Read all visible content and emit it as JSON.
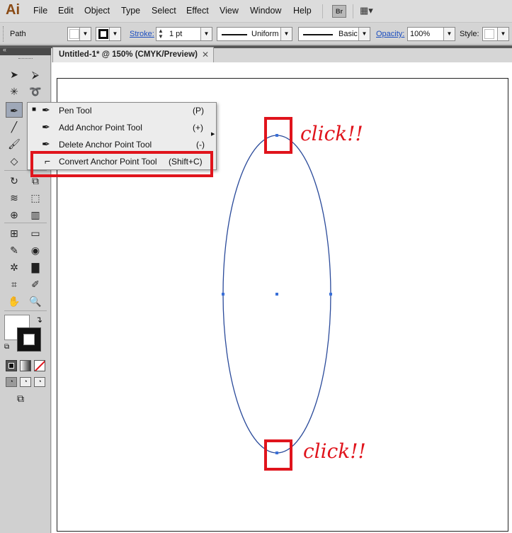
{
  "app": {
    "logo": "Ai"
  },
  "menu": [
    "File",
    "Edit",
    "Object",
    "Type",
    "Select",
    "Effect",
    "View",
    "Window",
    "Help"
  ],
  "menu_extra": {
    "bridge": "Br",
    "arrange": "▦▾"
  },
  "control_bar": {
    "selection_type": "Path",
    "stroke_label": "Stroke:",
    "stroke_weight": "1 pt",
    "profile": "Uniform",
    "brush": "Basic",
    "opacity_label": "Opacity:",
    "opacity_value": "100%",
    "style_label": "Style:"
  },
  "document_tab": {
    "title": "Untitled-1* @ 150% (CMYK/Preview)",
    "close": "✕"
  },
  "flyout": {
    "items": [
      {
        "label": "Pen Tool",
        "shortcut": "(P)",
        "selected": true
      },
      {
        "label": "Add Anchor Point Tool",
        "shortcut": "(+)",
        "selected": false
      },
      {
        "label": "Delete Anchor Point Tool",
        "shortcut": "(-)",
        "selected": false
      },
      {
        "label": "Convert Anchor Point Tool",
        "shortcut": "(Shift+C)",
        "selected": false
      }
    ]
  },
  "annotations": {
    "click_top": "click!!",
    "click_bottom": "click!!",
    "color": "#e0141c"
  },
  "tools": [
    "selection-tool",
    "direct-selection-tool",
    "magic-wand-tool",
    "lasso-tool",
    "pen-tool",
    "type-tool",
    "line-tool",
    "rectangle-tool",
    "paintbrush-tool",
    "pencil-tool",
    "eraser-tool",
    "rotate-tool",
    "scale-tool",
    "width-tool",
    "free-transform-tool",
    "shape-builder-tool",
    "perspective-grid-tool",
    "mesh-tool",
    "gradient-tool",
    "eyedropper-tool",
    "blend-tool",
    "symbol-sprayer-tool",
    "column-graph-tool",
    "artboard-tool",
    "slice-tool",
    "hand-tool",
    "zoom-tool"
  ],
  "colors": {
    "path_stroke": "#2a4a9a",
    "anchor": "#3a70d8"
  }
}
